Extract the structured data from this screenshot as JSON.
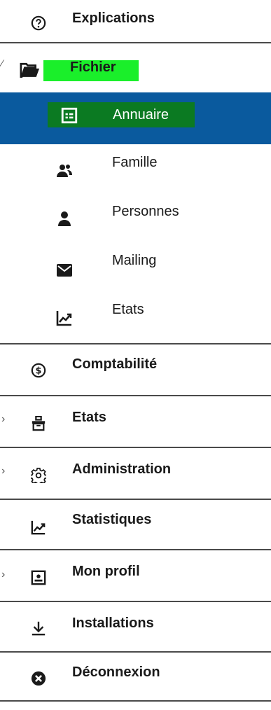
{
  "menu": {
    "explications": "Explications",
    "fichier": "Fichier",
    "annuaire": "Annuaire",
    "famille": "Famille",
    "personnes": "Personnes",
    "mailing": "Mailing",
    "etats_sub": "Etats",
    "comptabilite": "Comptabilité",
    "etats": "Etats",
    "administration": "Administration",
    "statistiques": "Statistiques",
    "mon_profil": "Mon profil",
    "installations": "Installations",
    "deconnexion": "Déconnexion"
  },
  "colors": {
    "active_bg": "#0a5a9e",
    "highlight": "#1aef2a",
    "divider": "#4a4a4a"
  },
  "icons": [
    "help-icon",
    "folder-open-icon",
    "address-book-icon",
    "users-icon",
    "user-icon",
    "envelope-icon",
    "chart-line-icon",
    "dollar-circle-icon",
    "archive-icon",
    "gear-icon",
    "chart-line-icon",
    "id-card-icon",
    "download-icon",
    "close-circle-icon"
  ]
}
